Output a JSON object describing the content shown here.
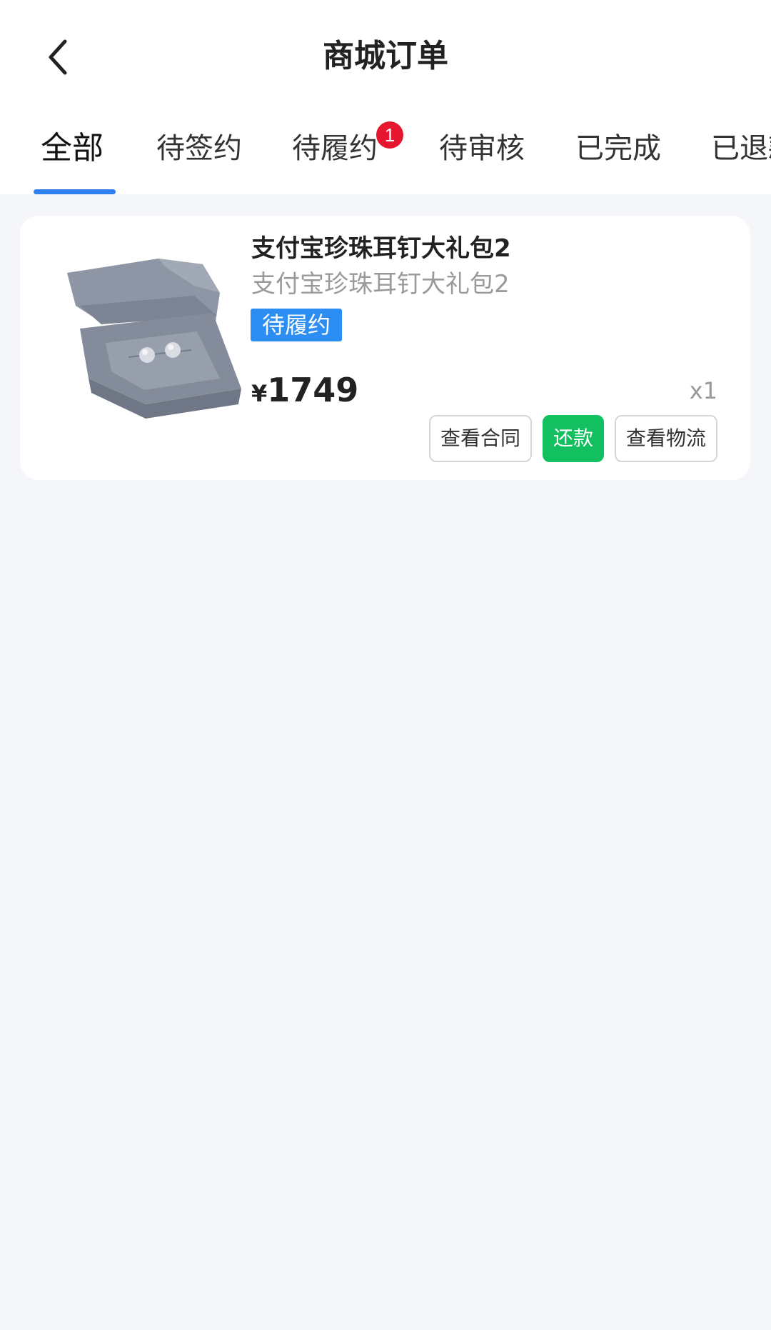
{
  "header": {
    "title": "商城订单",
    "back_icon": "chevron-left-icon"
  },
  "tabs": [
    {
      "label": "全部",
      "active": true
    },
    {
      "label": "待签约"
    },
    {
      "label": "待履约",
      "badge": "1"
    },
    {
      "label": "待审核"
    },
    {
      "label": "已完成"
    },
    {
      "label": "已退款"
    }
  ],
  "order": {
    "product_image": "pearl-earrings-in-gray-box",
    "product_name": "支付宝珍珠耳钉大礼包2",
    "product_subtitle": "支付宝珍珠耳钉大礼包2",
    "status": "待履约",
    "currency": "¥",
    "price": "1749",
    "quantity": "x1",
    "buttons": {
      "contract": "查看合同",
      "repay": "还款",
      "logistics": "查看物流"
    }
  },
  "colors": {
    "accent": "#2f80ed",
    "status_tag": "#2c8ef2",
    "repay_button": "#12c05f",
    "badge": "#e5162d",
    "background": "#f5f6fa"
  }
}
